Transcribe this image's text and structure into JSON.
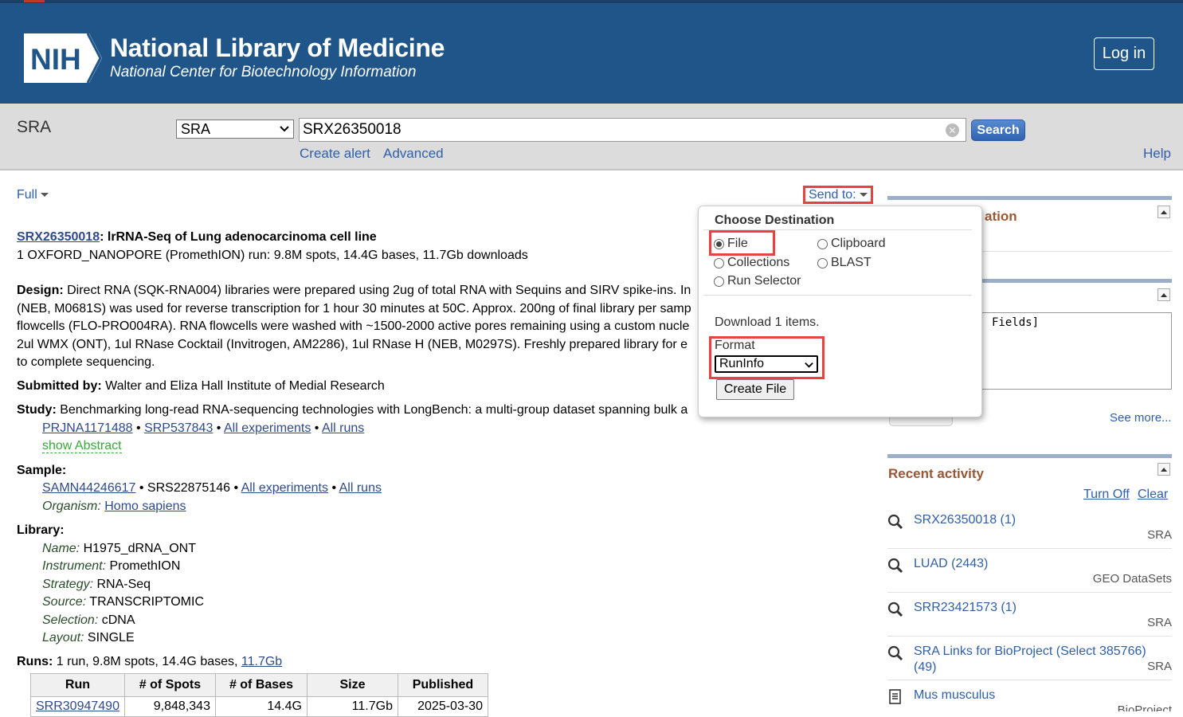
{
  "header": {
    "logo_text": "NIH",
    "title": "National Library of Medicine",
    "subtitle": "National Center for Biotechnology Information",
    "login_label": "Log in"
  },
  "search": {
    "db_title": "SRA",
    "db_selected": "SRA",
    "query": "SRX26350018",
    "search_label": "Search",
    "create_alert": "Create alert",
    "advanced": "Advanced",
    "help": "Help"
  },
  "toolbar": {
    "display_format": "Full",
    "send_to": "Send to:"
  },
  "record": {
    "accession": "SRX26350018",
    "title": ": lrRNA-Seq of Lung adenocarcinoma cell line",
    "summary": "1 OXFORD_NANOPORE (PromethION) run: 9.8M spots, 14.4G bases, 11.7Gb downloads",
    "design_label": "Design:",
    "design_text": " Direct RNA (SQK-RNA004) libraries were prepared using 2ug of total RNA with Sequins and SIRV spike-ins. In",
    "design_text2": "(NEB, M0681S) was used for reverse transcription for 1 hour 30 minutes at 50C. Approx. 200ng of final library per samp",
    "design_text3": "flowcells (FLO-PRO004RA). RNA flowcells were washed with ~1500-2000 active pores remaining using a custom nucle",
    "design_text4": "2ul WMX (ONT), 1ul RNase Cocktail (Invitrogen, AM2286), 1ul RNase H (NEB, M0297S). Freshly prepared library for e",
    "design_text5": "to complete sequencing.",
    "submitted_label": "Submitted by:",
    "submitted_text": " Walter and Eliza Hall Institute of Medial Research",
    "study_label": "Study:",
    "study_text": " Benchmarking long-read RNA-sequencing technologies with LongBench: a multi-group dataset spanning bulk a",
    "study_links": [
      "PRJNA1171488",
      "SRP537843",
      "All experiments",
      "All runs"
    ],
    "show_abstract": "show Abstract",
    "sample_label": "Sample:",
    "sample_link": "SAMN44246617",
    "sample_id": "SRS22875146",
    "sample_links": [
      "All experiments",
      "All runs"
    ],
    "organism_label": "Organism:",
    "organism": "Homo sapiens",
    "library_label": "Library:",
    "library": [
      {
        "k": "Name:",
        "v": " H1975_dRNA_ONT"
      },
      {
        "k": "Instrument:",
        "v": " PromethION"
      },
      {
        "k": "Strategy:",
        "v": " RNA-Seq"
      },
      {
        "k": "Source:",
        "v": " TRANSCRIPTOMIC"
      },
      {
        "k": "Selection:",
        "v": " cDNA"
      },
      {
        "k": "Layout:",
        "v": " SINGLE"
      }
    ],
    "runs_label": "Runs:",
    "runs_text": " 1 run, 9.8M spots, 14.4G bases, ",
    "runs_link": "11.7Gb"
  },
  "runs_table": {
    "headers": [
      "Run",
      "# of Spots",
      "# of Bases",
      "Size",
      "Published"
    ],
    "rows": [
      [
        "SRR30947490",
        "9,848,343",
        "14.4G",
        "11.7Gb",
        "2025-03-30"
      ]
    ]
  },
  "sidebar": {
    "section1_heading_partial": "ation",
    "search_details_text": "Fields]",
    "see_more": "See more...",
    "recent_heading": "Recent activity",
    "turn_off": "Turn Off",
    "clear": "Clear",
    "recent": [
      {
        "text": "SRX26350018 (1)",
        "db": "SRA",
        "icon": "search-icon"
      },
      {
        "text": "LUAD (2443)",
        "db": "GEO DataSets",
        "icon": "search-icon"
      },
      {
        "text": "SRR23421573 (1)",
        "db": "SRA",
        "icon": "search-icon"
      },
      {
        "text": "SRA Links for BioProject (Select 385766) (49)",
        "db": "SRA",
        "icon": "search-icon"
      },
      {
        "text": "Mus musculus",
        "db": "BioProject",
        "icon": "document-icon"
      }
    ]
  },
  "popup": {
    "title": "Choose Destination",
    "options": [
      "File",
      "Clipboard",
      "Collections",
      "BLAST",
      "Run Selector"
    ],
    "selected": "File",
    "download_text": "Download 1 items.",
    "format_label": "Format",
    "format_value": "RunInfo",
    "create_label": "Create File"
  },
  "colors": {
    "header_bg": "#20558a",
    "highlight": "#e84242",
    "link": "#2f4a8a",
    "sidebar_heading": "#985735"
  }
}
